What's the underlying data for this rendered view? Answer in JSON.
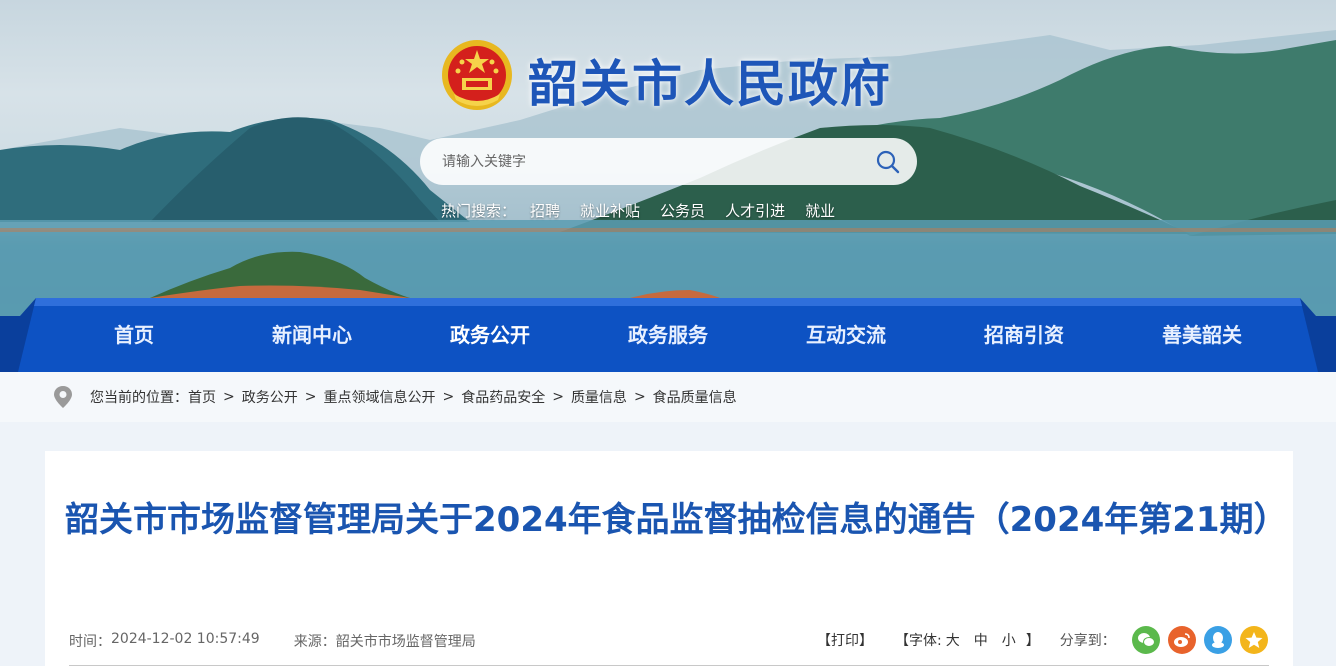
{
  "site": {
    "title": "韶关市人民政府"
  },
  "search": {
    "placeholder": "请输入关键字",
    "hot_label": "热门搜索：",
    "hot_items": [
      "招聘",
      "就业补贴",
      "公务员",
      "人才引进",
      "就业"
    ]
  },
  "nav": {
    "items": [
      "首页",
      "新闻中心",
      "政务公开",
      "政务服务",
      "互动交流",
      "招商引资",
      "善美韶关"
    ],
    "active": "政务公开"
  },
  "breadcrumb": {
    "prefix": "您当前的位置：",
    "items": [
      "首页",
      "政务公开",
      "重点领域信息公开",
      "食品药品安全",
      "质量信息",
      "食品质量信息"
    ],
    "separator": ">"
  },
  "article": {
    "title": "韶关市市场监督管理局关于2024年食品监督抽检信息的通告（2024年第21期）",
    "time_label": "时间：",
    "time": "2024-12-02 10:57:49",
    "source_label": "来源：",
    "source": "韶关市市场监督管理局",
    "print": "【打印】",
    "font_label": "【字体:",
    "font_sizes": [
      "大",
      "中",
      "小"
    ],
    "font_close": "】",
    "share_label": "分享到："
  },
  "colors": {
    "nav_bg": "#0d52c3",
    "title_blue": "#1a55b0",
    "wechat": "#5bb94c",
    "weibo": "#e8632c",
    "qq": "#3aa0e5",
    "qzone": "#f3b51b"
  },
  "icons": [
    "national-emblem-icon",
    "search-icon",
    "location-pin-icon",
    "wechat-icon",
    "weibo-icon",
    "qq-icon",
    "qzone-icon"
  ]
}
